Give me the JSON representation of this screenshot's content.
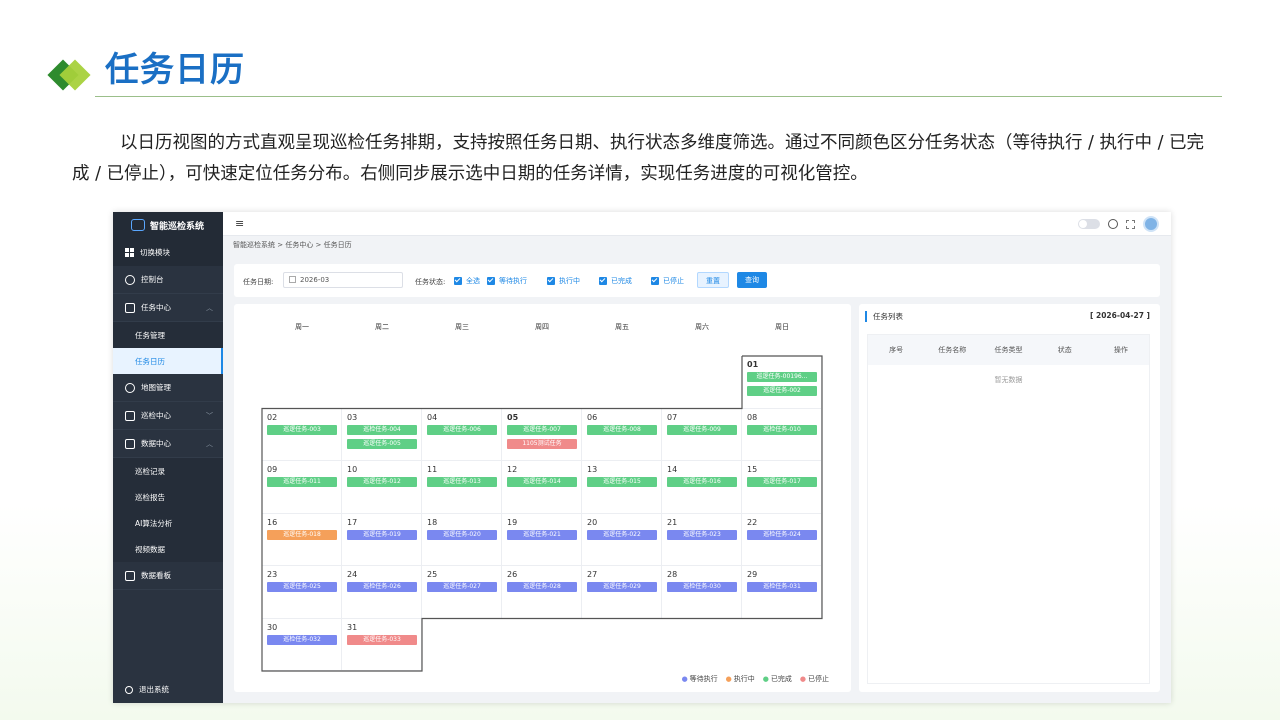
{
  "slide": {
    "title": "任务日历",
    "description": "以日历视图的方式直观呈现巡检任务排期，支持按照任务日期、执行状态多维度筛选。通过不同颜色区分任务状态（等待执行 / 执行中 / 已完成 / 已停止），可快速定位任务分布。右侧同步展示选中日期的任务详情，实现任务进度的可视化管控。"
  },
  "sidebar": {
    "brand": "智能巡检系统",
    "switch_module": "切换模块",
    "items": [
      {
        "label": "控制台"
      },
      {
        "label": "任务中心"
      },
      {
        "label": "任务管理"
      },
      {
        "label": "任务日历"
      },
      {
        "label": "地图管理"
      },
      {
        "label": "巡检中心"
      },
      {
        "label": "数据中心"
      },
      {
        "label": "巡检记录"
      },
      {
        "label": "巡检报告"
      },
      {
        "label": "AI算法分析"
      },
      {
        "label": "视频数据"
      },
      {
        "label": "数据看板"
      }
    ],
    "logout": "退出系统"
  },
  "topbar": {
    "menu_glyph": "≡"
  },
  "breadcrumb": "智能巡检系统 > 任务中心 > 任务日历",
  "filter": {
    "date_label": "任务日期:",
    "date_value": "2026-03",
    "status_label": "任务状态:",
    "options": [
      "全选",
      "等待执行",
      "执行中",
      "已完成",
      "已停止"
    ],
    "reset": "重置",
    "query": "查询"
  },
  "calendar": {
    "weekdays": [
      "周一",
      "周二",
      "周三",
      "周四",
      "周五",
      "周六",
      "周日"
    ],
    "days": [
      {
        "d": "01",
        "tasks": [
          {
            "t": "巡逻任务-00196...",
            "s": "done"
          },
          {
            "t": "巡逻任务-002",
            "s": "done"
          }
        ]
      },
      {
        "d": "02",
        "tasks": [
          {
            "t": "巡逻任务-003",
            "s": "done"
          }
        ]
      },
      {
        "d": "03",
        "tasks": [
          {
            "t": "巡检任务-004",
            "s": "done"
          },
          {
            "t": "巡逻任务-005",
            "s": "done"
          }
        ]
      },
      {
        "d": "04",
        "tasks": [
          {
            "t": "巡逻任务-006",
            "s": "done"
          }
        ]
      },
      {
        "d": "05",
        "tasks": [
          {
            "t": "巡逻任务-007",
            "s": "done"
          },
          {
            "t": "1105测试任务",
            "s": "stop"
          }
        ]
      },
      {
        "d": "06",
        "tasks": [
          {
            "t": "巡逻任务-008",
            "s": "done"
          }
        ]
      },
      {
        "d": "07",
        "tasks": [
          {
            "t": "巡逻任务-009",
            "s": "done"
          }
        ]
      },
      {
        "d": "08",
        "tasks": [
          {
            "t": "巡检任务-010",
            "s": "done"
          }
        ]
      },
      {
        "d": "09",
        "tasks": [
          {
            "t": "巡逻任务-011",
            "s": "done"
          }
        ]
      },
      {
        "d": "10",
        "tasks": [
          {
            "t": "巡逻任务-012",
            "s": "done"
          }
        ]
      },
      {
        "d": "11",
        "tasks": [
          {
            "t": "巡逻任务-013",
            "s": "done"
          }
        ]
      },
      {
        "d": "12",
        "tasks": [
          {
            "t": "巡逻任务-014",
            "s": "done"
          }
        ]
      },
      {
        "d": "13",
        "tasks": [
          {
            "t": "巡逻任务-015",
            "s": "done"
          }
        ]
      },
      {
        "d": "14",
        "tasks": [
          {
            "t": "巡逻任务-016",
            "s": "done"
          }
        ]
      },
      {
        "d": "15",
        "tasks": [
          {
            "t": "巡逻任务-017",
            "s": "done"
          }
        ]
      },
      {
        "d": "16",
        "tasks": [
          {
            "t": "巡逻任务-018",
            "s": "run"
          }
        ]
      },
      {
        "d": "17",
        "tasks": [
          {
            "t": "巡逻任务-019",
            "s": "wait"
          }
        ]
      },
      {
        "d": "18",
        "tasks": [
          {
            "t": "巡逻任务-020",
            "s": "wait"
          }
        ]
      },
      {
        "d": "19",
        "tasks": [
          {
            "t": "巡逻任务-021",
            "s": "wait"
          }
        ]
      },
      {
        "d": "20",
        "tasks": [
          {
            "t": "巡逻任务-022",
            "s": "wait"
          }
        ]
      },
      {
        "d": "21",
        "tasks": [
          {
            "t": "巡逻任务-023",
            "s": "wait"
          }
        ]
      },
      {
        "d": "22",
        "tasks": [
          {
            "t": "巡检任务-024",
            "s": "wait"
          }
        ]
      },
      {
        "d": "23",
        "tasks": [
          {
            "t": "巡逻任务-025",
            "s": "wait"
          }
        ]
      },
      {
        "d": "24",
        "tasks": [
          {
            "t": "巡检任务-026",
            "s": "wait"
          }
        ]
      },
      {
        "d": "25",
        "tasks": [
          {
            "t": "巡逻任务-027",
            "s": "wait"
          }
        ]
      },
      {
        "d": "26",
        "tasks": [
          {
            "t": "巡逻任务-028",
            "s": "wait"
          }
        ]
      },
      {
        "d": "27",
        "tasks": [
          {
            "t": "巡逻任务-029",
            "s": "wait"
          }
        ]
      },
      {
        "d": "28",
        "tasks": [
          {
            "t": "巡检任务-030",
            "s": "wait"
          }
        ]
      },
      {
        "d": "29",
        "tasks": [
          {
            "t": "巡检任务-031",
            "s": "wait"
          }
        ]
      },
      {
        "d": "30",
        "tasks": [
          {
            "t": "巡检任务-032",
            "s": "wait"
          }
        ]
      },
      {
        "d": "31",
        "tasks": [
          {
            "t": "巡逻任务-033",
            "s": "stop"
          }
        ]
      }
    ],
    "legend": [
      "等待执行",
      "执行中",
      "已完成",
      "已停止"
    ],
    "colors": {
      "wait": "#7a88f0",
      "run": "#f5a05a",
      "done": "#5fcf86",
      "stop": "#f08a8a"
    }
  },
  "task_list": {
    "title": "任务列表",
    "date": "[ 2026-04-27 ]",
    "columns": [
      "序号",
      "任务名称",
      "任务类型",
      "状态",
      "操作"
    ],
    "empty": "暂无数据"
  }
}
